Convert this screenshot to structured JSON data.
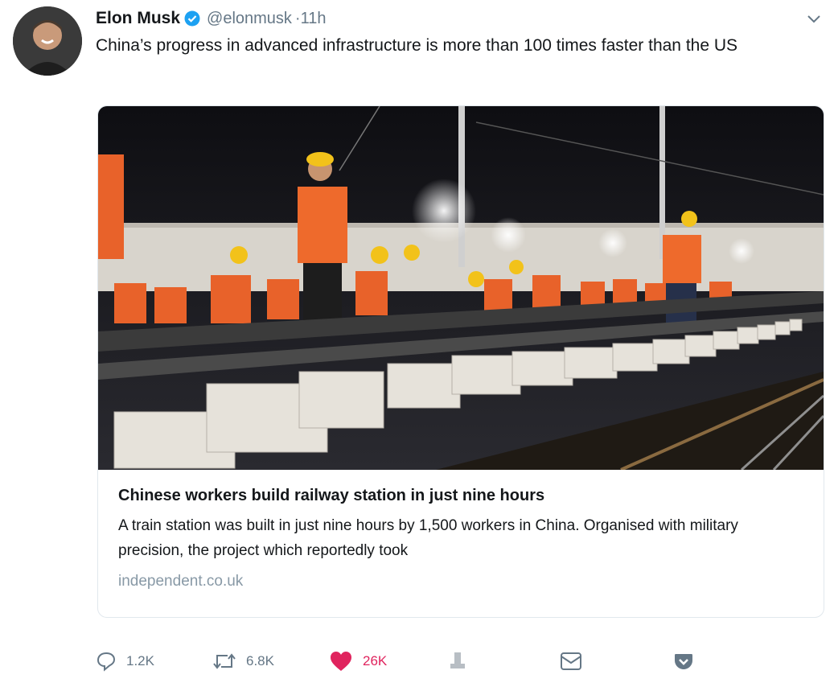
{
  "tweet": {
    "author_name": "Elon Musk",
    "handle": "@elonmusk",
    "time": "11h",
    "text": "China’s progress in advanced infrastructure is more than 100 times faster than the US",
    "verified": true
  },
  "card": {
    "image_icon": "photo-railway-workers",
    "title": "Chinese workers build railway station in just nine hours",
    "description": "A train station was built in just nine hours by 1,500 workers in China. Organised with military precision, the project which reportedly took",
    "domain": "independent.co.uk"
  },
  "actions": {
    "reply_count": "1.2K",
    "retweet_count": "6.8K",
    "like_count": "26K"
  },
  "colors": {
    "verified_blue": "#1da1f2",
    "like_red": "#e0245e",
    "muted_gray": "#657786"
  }
}
